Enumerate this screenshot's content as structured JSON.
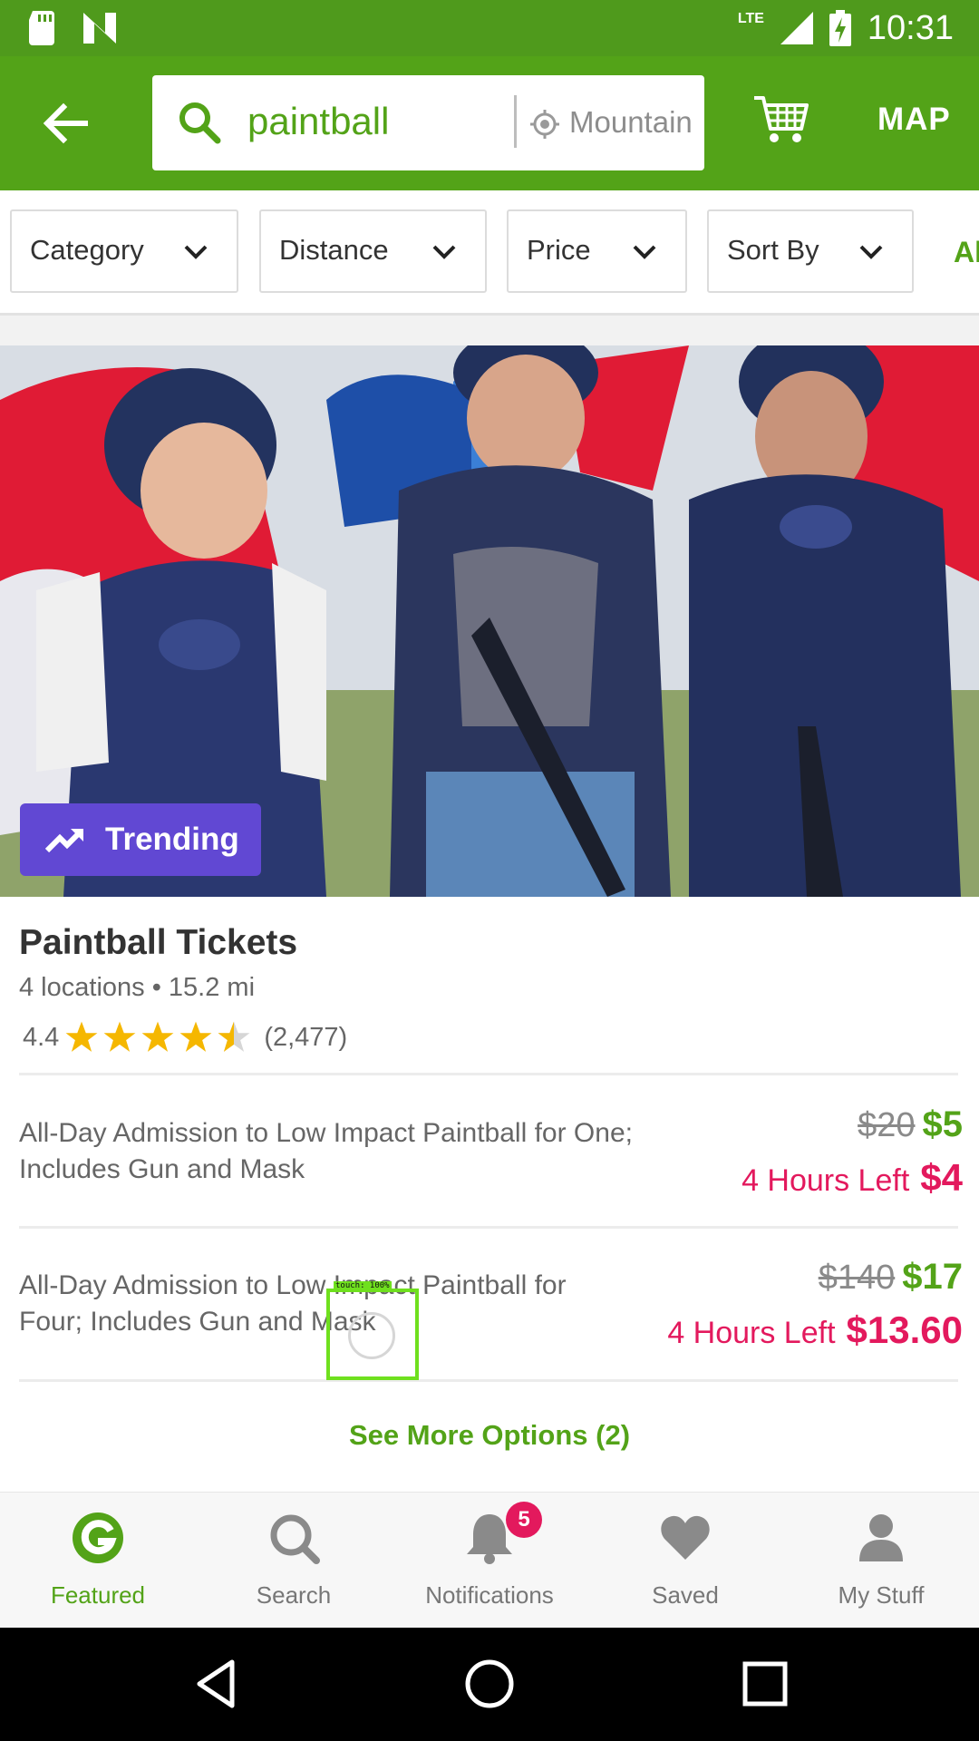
{
  "status_bar": {
    "time": "10:31",
    "network": "LTE"
  },
  "search": {
    "query": "paintball",
    "location": "Mountain"
  },
  "header": {
    "map_label": "MAP"
  },
  "filters": [
    {
      "label": "Category"
    },
    {
      "label": "Distance"
    },
    {
      "label": "Price"
    },
    {
      "label": "Sort By"
    }
  ],
  "filters_overflow": "Al",
  "deal": {
    "badge": "Trending",
    "title": "Paintball Tickets",
    "meta": "4 locations • 15.2 mi",
    "rating": "4.4",
    "rating_value": 4.4,
    "review_count": "(2,477)",
    "options": [
      {
        "description": "All-Day Admission to Low Impact Paintball for One; Includes Gun and Mask",
        "original_price": "$20",
        "sale_price": "$5",
        "limited_label": "4 Hours Left",
        "limited_price": "$4"
      },
      {
        "description": "All-Day Admission to Low Impact Paintball for Four; Includes Gun and Mask",
        "original_price": "$140",
        "sale_price": "$17",
        "limited_label": "4 Hours Left",
        "limited_price": "$13.60"
      }
    ],
    "see_more": "See More Options (2)"
  },
  "touch_overlay": {
    "label": "touch: 100%"
  },
  "bottom_nav": {
    "items": [
      {
        "label": "Featured",
        "icon": "groupon-g-icon"
      },
      {
        "label": "Search",
        "icon": "search-icon"
      },
      {
        "label": "Notifications",
        "icon": "bell-icon"
      },
      {
        "label": "Saved",
        "icon": "heart-icon"
      },
      {
        "label": "My Stuff",
        "icon": "person-icon"
      }
    ],
    "notification_count": "5"
  },
  "colors": {
    "brand_green": "#53a318",
    "status_green": "#4f9a1c",
    "trending_purple": "#6148d3",
    "limited_pink": "#e3195d",
    "star_gold": "#f5b700"
  }
}
